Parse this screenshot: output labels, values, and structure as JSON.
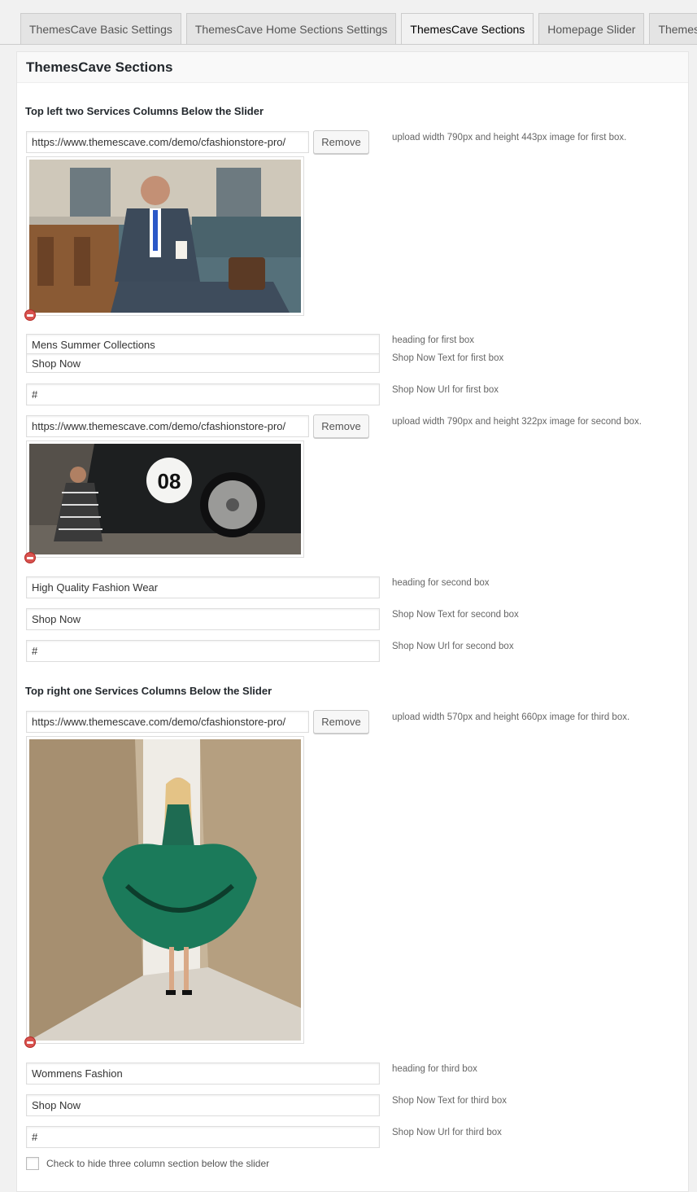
{
  "tabs": [
    "ThemesCave Basic Settings",
    "ThemesCave Home Sections Settings",
    "ThemesCave Sections",
    "Homepage Slider",
    "ThemesCave"
  ],
  "panel_title": "ThemesCave Sections",
  "section1_title": "Top left two Services Columns Below the Slider",
  "section2_title": "Top right one Services Columns Below the Slider",
  "remove_label": "Remove",
  "box1": {
    "image_url": "https://www.themescave.com/demo/cfashionstore-pro/",
    "image_desc": "upload width 790px and height 443px image for first box.",
    "heading_value": "Mens Summer Collections",
    "heading_desc": "heading for first box",
    "shopnow_value": "Shop Now",
    "shopnow_desc": "Shop Now Text for first box",
    "url_value": "#",
    "url_desc": "Shop Now Url for first box"
  },
  "box2": {
    "image_url": "https://www.themescave.com/demo/cfashionstore-pro/",
    "image_desc": "upload width 790px and height 322px image for second box.",
    "car_number": "08",
    "heading_value": "High Quality Fashion Wear",
    "heading_desc": "heading for second box",
    "shopnow_value": "Shop Now",
    "shopnow_desc": "Shop Now Text for second box",
    "url_value": "#",
    "url_desc": "Shop Now Url for second box"
  },
  "box3": {
    "image_url": "https://www.themescave.com/demo/cfashionstore-pro/",
    "image_desc": "upload width 570px and height 660px image for third box.",
    "heading_value": "Wommens Fashion",
    "heading_desc": "heading for third box",
    "shopnow_value": "Shop Now",
    "shopnow_desc": "Shop Now Text for third box",
    "url_value": "#",
    "url_desc": "Shop Now Url for third box"
  },
  "hide_checkbox_label": "Check to hide three column section below the slider"
}
